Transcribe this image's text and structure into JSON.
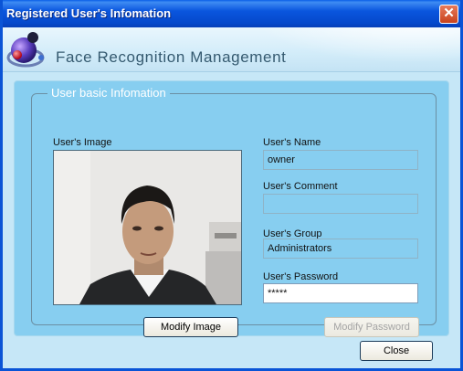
{
  "window": {
    "title": "Registered User's Infomation",
    "close_glyph": "✕"
  },
  "header": {
    "title": "Face Recognition Management",
    "logo_icon": "globe-logo-icon"
  },
  "group": {
    "legend": "User basic Infomation"
  },
  "image": {
    "label": "User's Image",
    "modify_label": "Modify Image"
  },
  "fields": {
    "name": {
      "label": "User's Name",
      "value": "owner"
    },
    "comment": {
      "label": "User's Comment",
      "value": ""
    },
    "group": {
      "label": "User's Group",
      "value": "Administrators"
    },
    "password": {
      "label": "User's Password",
      "value": "*****"
    }
  },
  "modify_password_label": "Modify Password",
  "close_label": "Close",
  "colors": {
    "title_bar": "#0a54d6",
    "panel": "#87cef0",
    "client": "#c6e7f7"
  }
}
